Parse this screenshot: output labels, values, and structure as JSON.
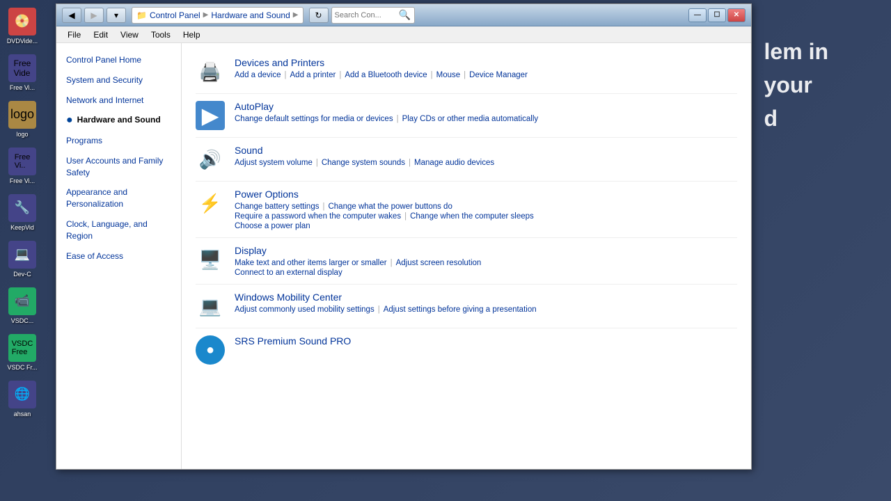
{
  "window": {
    "title": "Hardware and Sound",
    "address": {
      "parts": [
        "Control Panel",
        "Hardware and Sound"
      ],
      "separators": [
        "▶",
        "▶"
      ]
    },
    "search_placeholder": "Search Con...",
    "controls": {
      "minimize": "—",
      "maximize": "☐",
      "close": "✕"
    }
  },
  "menu": {
    "items": [
      "File",
      "Edit",
      "View",
      "Tools",
      "Help"
    ]
  },
  "sidebar": {
    "items": [
      {
        "id": "control-panel-home",
        "label": "Control Panel Home",
        "active": false,
        "bullet": false
      },
      {
        "id": "system-and-security",
        "label": "System and Security",
        "active": false,
        "bullet": false
      },
      {
        "id": "network-and-internet",
        "label": "Network and Internet",
        "active": false,
        "bullet": false
      },
      {
        "id": "hardware-and-sound",
        "label": "Hardware and Sound",
        "active": true,
        "bullet": true
      },
      {
        "id": "programs",
        "label": "Programs",
        "active": false,
        "bullet": false
      },
      {
        "id": "user-accounts",
        "label": "User Accounts and Family Safety",
        "active": false,
        "bullet": false
      },
      {
        "id": "appearance",
        "label": "Appearance and Personalization",
        "active": false,
        "bullet": false
      },
      {
        "id": "clock-language",
        "label": "Clock, Language, and Region",
        "active": false,
        "bullet": false
      },
      {
        "id": "ease-of-access",
        "label": "Ease of Access",
        "active": false,
        "bullet": false
      }
    ]
  },
  "categories": [
    {
      "id": "devices-printers",
      "icon": "🖨️",
      "title": "Devices and Printers",
      "links": [
        {
          "id": "add-device",
          "label": "Add a device"
        },
        {
          "id": "add-printer",
          "label": "Add a printer"
        },
        {
          "id": "add-bluetooth",
          "label": "Add a Bluetooth device"
        },
        {
          "id": "mouse",
          "label": "Mouse"
        },
        {
          "id": "device-manager",
          "label": "Device Manager"
        }
      ]
    },
    {
      "id": "autoplay",
      "icon": "▶️",
      "title": "AutoPlay",
      "links": [
        {
          "id": "change-default-settings",
          "label": "Change default settings for media or devices"
        },
        {
          "id": "play-cds",
          "label": "Play CDs or other media automatically"
        }
      ]
    },
    {
      "id": "sound",
      "icon": "🔊",
      "title": "Sound",
      "links": [
        {
          "id": "adjust-volume",
          "label": "Adjust system volume"
        },
        {
          "id": "change-sounds",
          "label": "Change system sounds"
        },
        {
          "id": "manage-audio",
          "label": "Manage audio devices"
        }
      ]
    },
    {
      "id": "power-options",
      "icon": "⚡",
      "title": "Power Options",
      "links": [
        {
          "id": "change-battery",
          "label": "Change battery settings"
        },
        {
          "id": "power-buttons",
          "label": "Change what the power buttons do"
        },
        {
          "id": "require-password",
          "label": "Require a password when the computer wakes"
        },
        {
          "id": "change-sleeps",
          "label": "Change when the computer sleeps"
        },
        {
          "id": "choose-plan",
          "label": "Choose a power plan"
        }
      ],
      "multiline": true
    },
    {
      "id": "display",
      "icon": "🖥️",
      "title": "Display",
      "links": [
        {
          "id": "make-text-larger",
          "label": "Make text and other items larger or smaller"
        },
        {
          "id": "adjust-resolution",
          "label": "Adjust screen resolution"
        },
        {
          "id": "connect-external",
          "label": "Connect to an external display"
        }
      ],
      "multiline": true
    },
    {
      "id": "windows-mobility",
      "icon": "💻",
      "title": "Windows Mobility Center",
      "links": [
        {
          "id": "adjust-mobility",
          "label": "Adjust commonly used mobility settings"
        },
        {
          "id": "adjust-presentation",
          "label": "Adjust settings before giving a presentation"
        }
      ]
    },
    {
      "id": "srs-premium",
      "icon": "🔵",
      "title": "SRS Premium Sound PRO",
      "links": []
    }
  ],
  "bg_text": {
    "line1": "lem in",
    "line2": "your",
    "line3": "d"
  }
}
